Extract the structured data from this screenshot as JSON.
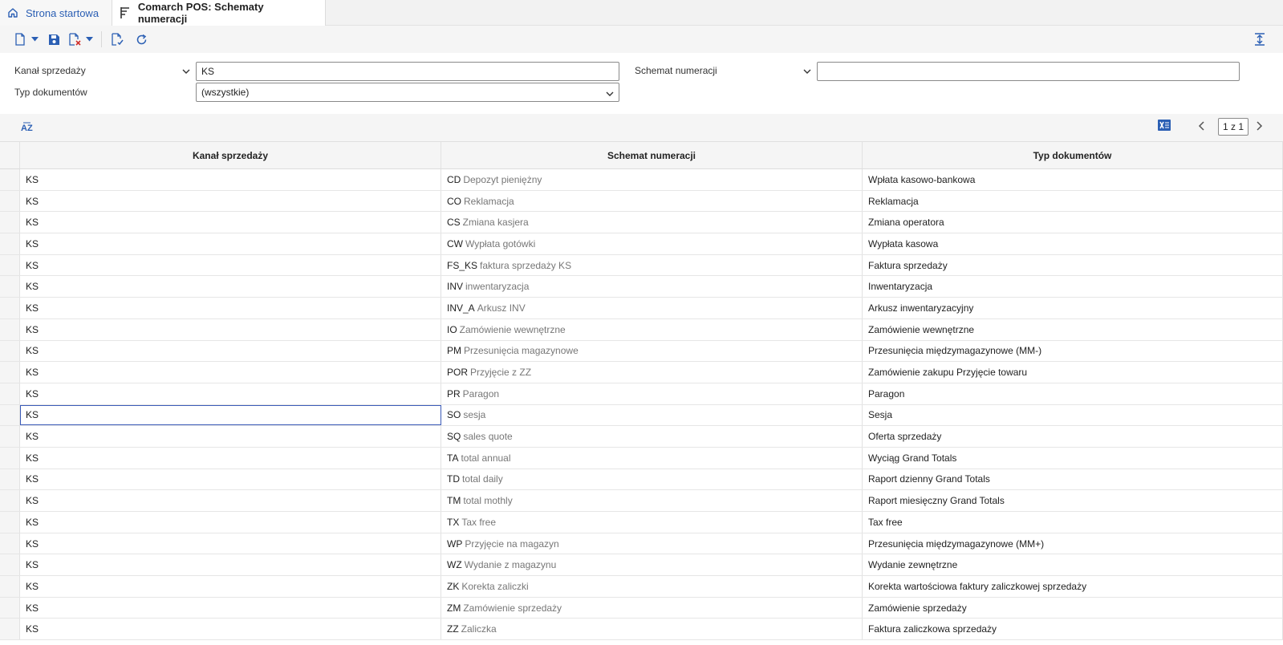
{
  "tabs": {
    "home_label": "Strona startowa",
    "active_label": "Comarch POS: Schematy numeracji"
  },
  "filters": {
    "channel_label": "Kanał sprzedaży",
    "channel_value": "KS",
    "scheme_label": "Schemat numeracji",
    "scheme_value": "",
    "doc_type_label": "Typ dokumentów",
    "doc_type_value": "(wszystkie)"
  },
  "pagination": {
    "label": "1 z 1"
  },
  "grid": {
    "columns": [
      "Kanał sprzedaży",
      "Schemat numeracji",
      "Typ dokumentów"
    ],
    "rows": [
      {
        "channel": "KS",
        "code": "CD",
        "desc": "Depozyt pieniężny",
        "doc_type": "Wpłata kasowo-bankowa"
      },
      {
        "channel": "KS",
        "code": "CO",
        "desc": "Reklamacja",
        "doc_type": "Reklamacja"
      },
      {
        "channel": "KS",
        "code": "CS",
        "desc": "Zmiana kasjera",
        "doc_type": "Zmiana operatora"
      },
      {
        "channel": "KS",
        "code": "CW",
        "desc": "Wypłata gotówki",
        "doc_type": "Wypłata kasowa"
      },
      {
        "channel": "KS",
        "code": "FS_KS",
        "desc": "faktura sprzedaży KS",
        "doc_type": "Faktura sprzedaży"
      },
      {
        "channel": "KS",
        "code": "INV",
        "desc": "inwentaryzacja",
        "doc_type": "Inwentaryzacja"
      },
      {
        "channel": "KS",
        "code": "INV_A",
        "desc": "Arkusz INV",
        "doc_type": "Arkusz inwentaryzacyjny"
      },
      {
        "channel": "KS",
        "code": "IO",
        "desc": "Zamówienie wewnętrzne",
        "doc_type": "Zamówienie wewnętrzne"
      },
      {
        "channel": "KS",
        "code": "PM",
        "desc": "Przesunięcia magazynowe",
        "doc_type": "Przesunięcia międzymagazynowe (MM-)"
      },
      {
        "channel": "KS",
        "code": "POR",
        "desc": "Przyjęcie z ZZ",
        "doc_type": "Zamówienie zakupu Przyjęcie towaru"
      },
      {
        "channel": "KS",
        "code": "PR",
        "desc": "Paragon",
        "doc_type": "Paragon"
      },
      {
        "channel": "KS",
        "code": "SO",
        "desc": "sesja",
        "doc_type": "Sesja"
      },
      {
        "channel": "KS",
        "code": "SQ",
        "desc": "sales quote",
        "doc_type": "Oferta sprzedaży"
      },
      {
        "channel": "KS",
        "code": "TA",
        "desc": "total annual",
        "doc_type": "Wyciąg Grand Totals"
      },
      {
        "channel": "KS",
        "code": "TD",
        "desc": "total daily",
        "doc_type": "Raport dzienny Grand Totals"
      },
      {
        "channel": "KS",
        "code": "TM",
        "desc": "total mothly",
        "doc_type": "Raport miesięczny Grand Totals"
      },
      {
        "channel": "KS",
        "code": "TX",
        "desc": "Tax free",
        "doc_type": "Tax free"
      },
      {
        "channel": "KS",
        "code": "WP",
        "desc": "Przyjęcie na magazyn",
        "doc_type": "Przesunięcia międzymagazynowe (MM+)"
      },
      {
        "channel": "KS",
        "code": "WZ",
        "desc": "Wydanie z magazynu",
        "doc_type": "Wydanie zewnętrzne"
      },
      {
        "channel": "KS",
        "code": "ZK",
        "desc": "Korekta zaliczki",
        "doc_type": "Korekta wartościowa faktury zaliczkowej sprzedaży"
      },
      {
        "channel": "KS",
        "code": "ZM",
        "desc": "Zamówienie sprzedaży",
        "doc_type": "Zamówienie sprzedaży"
      },
      {
        "channel": "KS",
        "code": "ZZ",
        "desc": "Zaliczka",
        "doc_type": "Faktura zaliczkowa sprzedaży"
      }
    ]
  },
  "colors": {
    "accent": "#2b5fb4",
    "excel": "#2b5fb4",
    "delete": "#d0312d"
  }
}
